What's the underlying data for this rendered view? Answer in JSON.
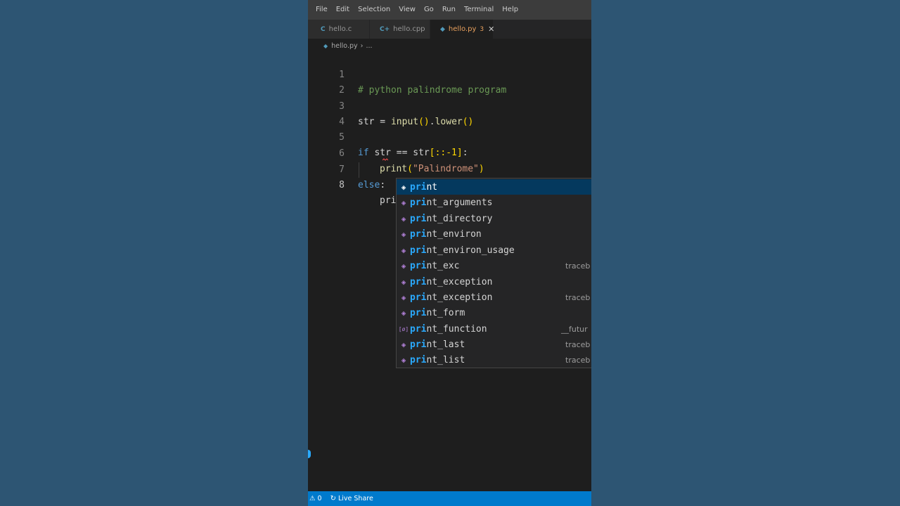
{
  "menu": [
    "File",
    "Edit",
    "Selection",
    "View",
    "Go",
    "Run",
    "Terminal",
    "Help"
  ],
  "tabs": [
    {
      "icon": "C",
      "label": "hello.c"
    },
    {
      "icon": "C+",
      "label": "hello.cpp"
    },
    {
      "icon": "◆",
      "label": "hello.py",
      "badge": "3",
      "close": "✕"
    }
  ],
  "breadcrumb": {
    "file": "hello.py",
    "sep": "›",
    "rest": "..."
  },
  "editor": {
    "line_numbers": [
      "1",
      "2",
      "3",
      "4",
      "5",
      "6",
      "7",
      "8"
    ],
    "line1_comment": "# python palindrome program",
    "line3_a": "str = ",
    "line3_fn": "input",
    "line3_p1": "()",
    "line3_dot": ".",
    "line3_fn2": "lower",
    "line3_p2": "()",
    "line5_kw": "if",
    "line5_a": " str == str",
    "line5_br": "[::-1]",
    "line5_colon": ":",
    "line6_fn": "print",
    "line6_p1": "(",
    "line6_str": "\"Palindrome\"",
    "line6_p2": ")",
    "line7_kw": "else",
    "line7_colon": ":",
    "line8_text": "pri"
  },
  "suggest": {
    "items": [
      {
        "match": "pri",
        "rest": "nt",
        "icon": "◈",
        "detail": ""
      },
      {
        "match": "pri",
        "rest": "nt_arguments",
        "icon": "◈",
        "detail": ""
      },
      {
        "match": "pri",
        "rest": "nt_directory",
        "icon": "◈",
        "detail": ""
      },
      {
        "match": "pri",
        "rest": "nt_environ",
        "icon": "◈",
        "detail": ""
      },
      {
        "match": "pri",
        "rest": "nt_environ_usage",
        "icon": "◈",
        "detail": ""
      },
      {
        "match": "pri",
        "rest": "nt_exc",
        "icon": "◈",
        "detail": "traceb"
      },
      {
        "match": "pri",
        "rest": "nt_exception",
        "icon": "◈",
        "detail": ""
      },
      {
        "match": "pri",
        "rest": "nt_exception",
        "icon": "◈",
        "detail": "traceb"
      },
      {
        "match": "pri",
        "rest": "nt_form",
        "icon": "◈",
        "detail": ""
      },
      {
        "match": "pri",
        "rest": "nt_function",
        "icon": "[ø]",
        "detail": "__futur"
      },
      {
        "match": "pri",
        "rest": "nt_last",
        "icon": "◈",
        "detail": "traceb"
      },
      {
        "match": "pri",
        "rest": "nt_list",
        "icon": "◈",
        "detail": "traceb"
      }
    ]
  },
  "status": {
    "problems": "⚠ 0",
    "problems_prefix": "0",
    "liveshare_icon": "↻",
    "liveshare": "Live Share"
  },
  "colors": {
    "statusbar": "#007acc",
    "background": "#2d5573",
    "editor": "#1e1e1e",
    "accent": "#2aaaff"
  }
}
